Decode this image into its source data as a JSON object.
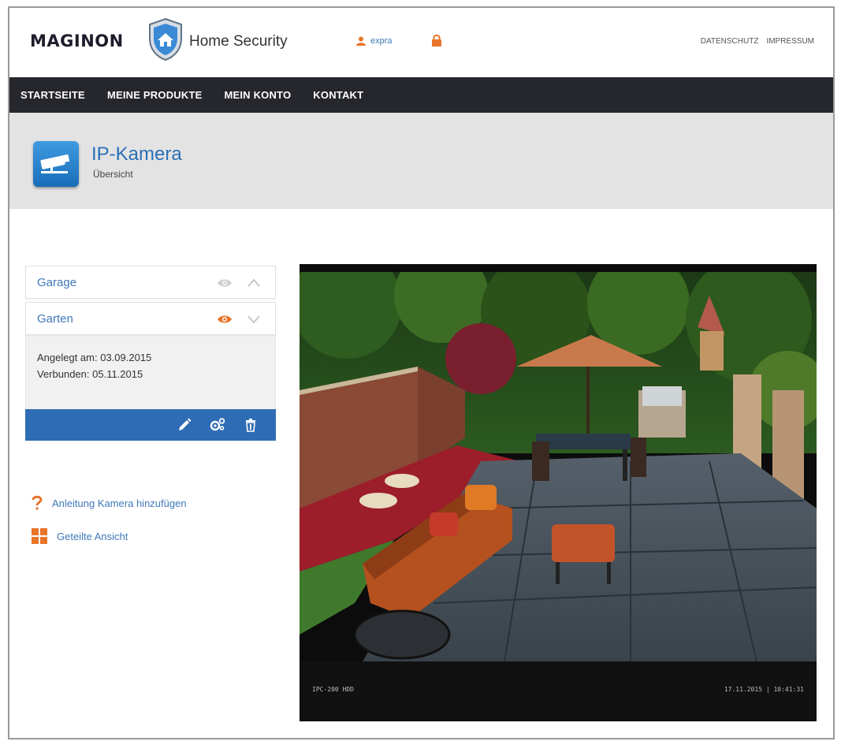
{
  "brand": {
    "logo": "MAGINON",
    "subtitle": "Home Security"
  },
  "header": {
    "username": "expra",
    "links": [
      "DATENSCHUTZ",
      "IMPRESSUM"
    ]
  },
  "nav": {
    "items": [
      "STARTSEITE",
      "MEINE PRODUKTE",
      "MEIN KONTO",
      "KONTAKT"
    ]
  },
  "page": {
    "title": "IP-Kamera",
    "subtitle": "Übersicht"
  },
  "cameras": [
    {
      "name": "Garage",
      "state": "collapsed",
      "live": false
    },
    {
      "name": "Garten",
      "state": "expanded",
      "live": true,
      "created": "Angelegt am: 03.09.2015",
      "connected": "Verbunden: 05.11.2015"
    }
  ],
  "help": {
    "add_camera": "Anleitung Kamera hinzufügen",
    "split_view": "Geteilte Ansicht"
  },
  "stream": {
    "model": "IPC-200 HDD",
    "timestamp": "17.11.2015 | 10:41:31"
  },
  "colors": {
    "accent": "#2e6db5",
    "nav_bg": "#26272d",
    "orange": "#e8742a",
    "link": "#3e78b8"
  }
}
